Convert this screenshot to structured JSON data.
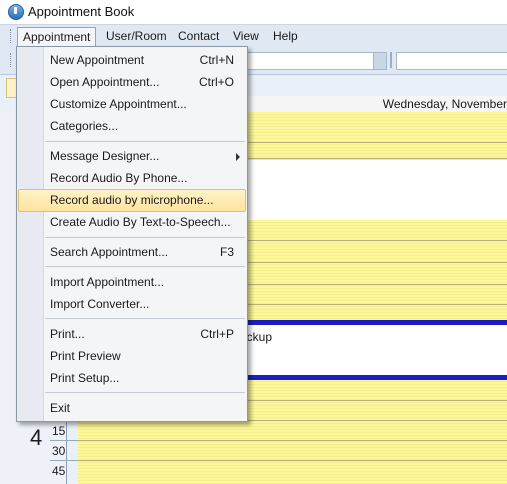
{
  "window": {
    "title": "Appointment Book"
  },
  "menubar": [
    "Appointment",
    "User/Room",
    "Contact",
    "View",
    "Help"
  ],
  "calendar": {
    "date_header": "Wednesday, November",
    "appointment_text": "eckup",
    "hour": "4",
    "minutes": [
      "15",
      "30",
      "45"
    ]
  },
  "appointment_menu": {
    "items": [
      {
        "label": "New Appointment",
        "shortcut": "Ctrl+N"
      },
      {
        "label": "Open Appointment...",
        "shortcut": "Ctrl+O"
      },
      {
        "label": "Customize Appointment...",
        "shortcut": ""
      },
      {
        "label": "Categories...",
        "shortcut": ""
      },
      {
        "label": "Message Designer...",
        "shortcut": ""
      },
      {
        "label": "Record Audio By Phone...",
        "shortcut": ""
      },
      {
        "label": "Record audio by microphone...",
        "shortcut": ""
      },
      {
        "label": "Create Audio By Text-to-Speech...",
        "shortcut": ""
      },
      {
        "label": "Search Appointment...",
        "shortcut": "F3"
      },
      {
        "label": "Import Appointment...",
        "shortcut": ""
      },
      {
        "label": "Import Converter...",
        "shortcut": ""
      },
      {
        "label": "Print...",
        "shortcut": "Ctrl+P"
      },
      {
        "label": "Print Preview",
        "shortcut": ""
      },
      {
        "label": "Print Setup...",
        "shortcut": ""
      },
      {
        "label": "Exit",
        "shortcut": ""
      }
    ],
    "highlighted": "Record audio by microphone..."
  }
}
